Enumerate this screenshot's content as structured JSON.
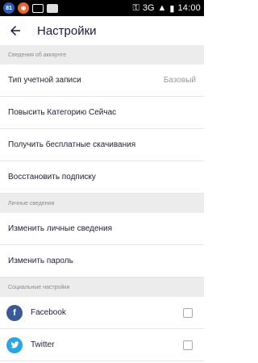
{
  "statusbar": {
    "badge1": "81",
    "network": "3G",
    "time": "14:00"
  },
  "appbar": {
    "title": "Настройки"
  },
  "sections": {
    "account": "Сведения об аккаунте",
    "personal": "Личные сведения",
    "social": "Социальные настройки"
  },
  "rows": {
    "account_type_label": "Тип учетной записи",
    "account_type_value": "Базовый",
    "upgrade": "Повысить Категорию Сейчас",
    "free_downloads": "Получить бесплатные скачивания",
    "restore": "Восстановить подписку",
    "edit_personal": "Изменить личные сведения",
    "change_password": "Изменить пароль"
  },
  "social": {
    "facebook": "Facebook",
    "twitter": "Twitter"
  },
  "colors": {
    "facebook": "#3b5998",
    "twitter": "#27a7e5",
    "section_bg": "#ececec"
  },
  "icons": {
    "back": "back-arrow-icon",
    "facebook": "facebook-icon",
    "twitter": "twitter-icon"
  }
}
